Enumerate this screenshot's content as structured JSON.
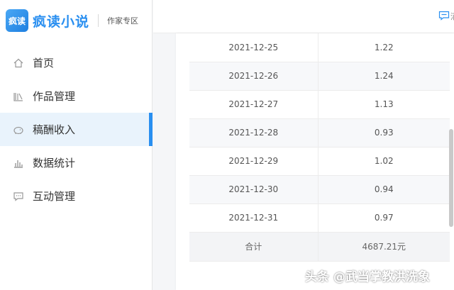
{
  "brand": {
    "logo_badge": "疯读",
    "name": "疯读小说",
    "section": "作家专区"
  },
  "nav": {
    "items": [
      {
        "label": "首页",
        "icon": "home-icon"
      },
      {
        "label": "作品管理",
        "icon": "books-icon"
      },
      {
        "label": "稿酬收入",
        "icon": "piggy-bank-icon",
        "active": true
      },
      {
        "label": "数据统计",
        "icon": "bar-chart-icon"
      },
      {
        "label": "互动管理",
        "icon": "chat-icon"
      }
    ]
  },
  "header": {
    "message_icon": "message-icon",
    "message_text_partial": "消"
  },
  "table": {
    "rows": [
      {
        "date": "2021-12-25",
        "amount": "1.22"
      },
      {
        "date": "2021-12-26",
        "amount": "1.24"
      },
      {
        "date": "2021-12-27",
        "amount": "1.13"
      },
      {
        "date": "2021-12-28",
        "amount": "0.93"
      },
      {
        "date": "2021-12-29",
        "amount": "1.02"
      },
      {
        "date": "2021-12-30",
        "amount": "0.94"
      },
      {
        "date": "2021-12-31",
        "amount": "0.97"
      }
    ],
    "total_label": "合计",
    "total_value": "4687.21元"
  },
  "watermark": "头条 @武当掌教洪洗象",
  "colors": {
    "accent": "#2a8ff0",
    "active_bg": "#e9f3fc"
  }
}
